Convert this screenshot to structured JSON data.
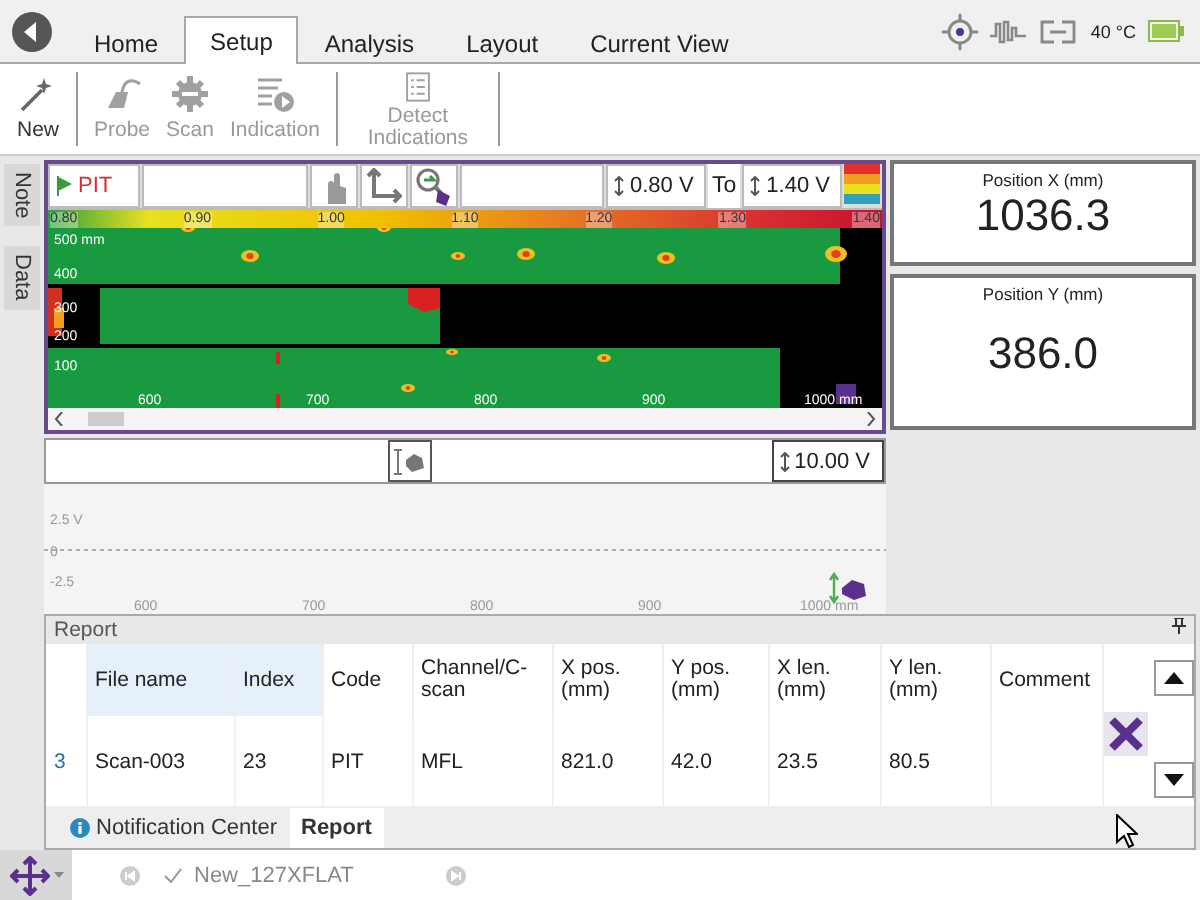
{
  "top_tabs": [
    {
      "label": "Home",
      "selected": false
    },
    {
      "label": "Setup",
      "selected": true
    },
    {
      "label": "Analysis",
      "selected": false
    },
    {
      "label": "Layout",
      "selected": false
    },
    {
      "label": "Current View",
      "selected": false
    }
  ],
  "status": {
    "temperature": "40 °C"
  },
  "ribbon": [
    {
      "label": "New",
      "kind": "wand",
      "disabled": false
    },
    {
      "label": "Probe",
      "kind": "probe",
      "disabled": true
    },
    {
      "label": "Scan",
      "kind": "gear",
      "disabled": true
    },
    {
      "label": "Indication",
      "kind": "indication",
      "disabled": true
    },
    {
      "label": "Detect Indications",
      "kind": "list",
      "disabled": true
    }
  ],
  "side_tabs": [
    {
      "label": "Note"
    },
    {
      "label": "Data"
    }
  ],
  "cscan": {
    "indication": "PIT",
    "min": "0.80 V",
    "to": "To",
    "max": "1.40 V",
    "scale_labels": [
      "0.80",
      "0.90",
      "1.00",
      "1.10",
      "1.20",
      "1.30",
      "1.40"
    ],
    "y_labels": [
      "500 mm",
      "400",
      "300",
      "200",
      "100"
    ],
    "x_labels": [
      "600",
      "700",
      "800",
      "900",
      "1000 mm"
    ]
  },
  "ascan": {
    "range": "10.00 V",
    "y_labels": [
      "2.5 V",
      "0",
      "-2.5"
    ],
    "x_labels": [
      "600",
      "700",
      "800",
      "900",
      "1000 mm"
    ]
  },
  "readouts": [
    {
      "label": "Position X (mm)",
      "value": "1036.3"
    },
    {
      "label": "Position Y (mm)",
      "value": "386.0"
    }
  ],
  "report": {
    "title": "Report",
    "columns": [
      {
        "label": "File name",
        "sorted": true
      },
      {
        "label": "Index",
        "sorted": true
      },
      {
        "label": "Code",
        "sorted": false
      },
      {
        "label": "Channel/C-scan",
        "sorted": false
      },
      {
        "label": "X pos. (mm)",
        "sorted": false
      },
      {
        "label": "Y pos. (mm)",
        "sorted": false
      },
      {
        "label": "X len. (mm)",
        "sorted": false
      },
      {
        "label": "Y len. (mm)",
        "sorted": false
      },
      {
        "label": "Comment",
        "sorted": false
      }
    ],
    "rows": [
      {
        "number": "3",
        "cells": [
          "Scan-003",
          "23",
          "PIT",
          "MFL",
          "821.0",
          "42.0",
          "23.5",
          "80.5"
        ]
      }
    ]
  },
  "bottom_tabs": [
    {
      "label": "Notification Center",
      "kind": "info",
      "selected": false
    },
    {
      "label": "Report",
      "kind": "plain",
      "selected": true
    }
  ],
  "status_bar": {
    "file": "New_127XFLAT"
  }
}
